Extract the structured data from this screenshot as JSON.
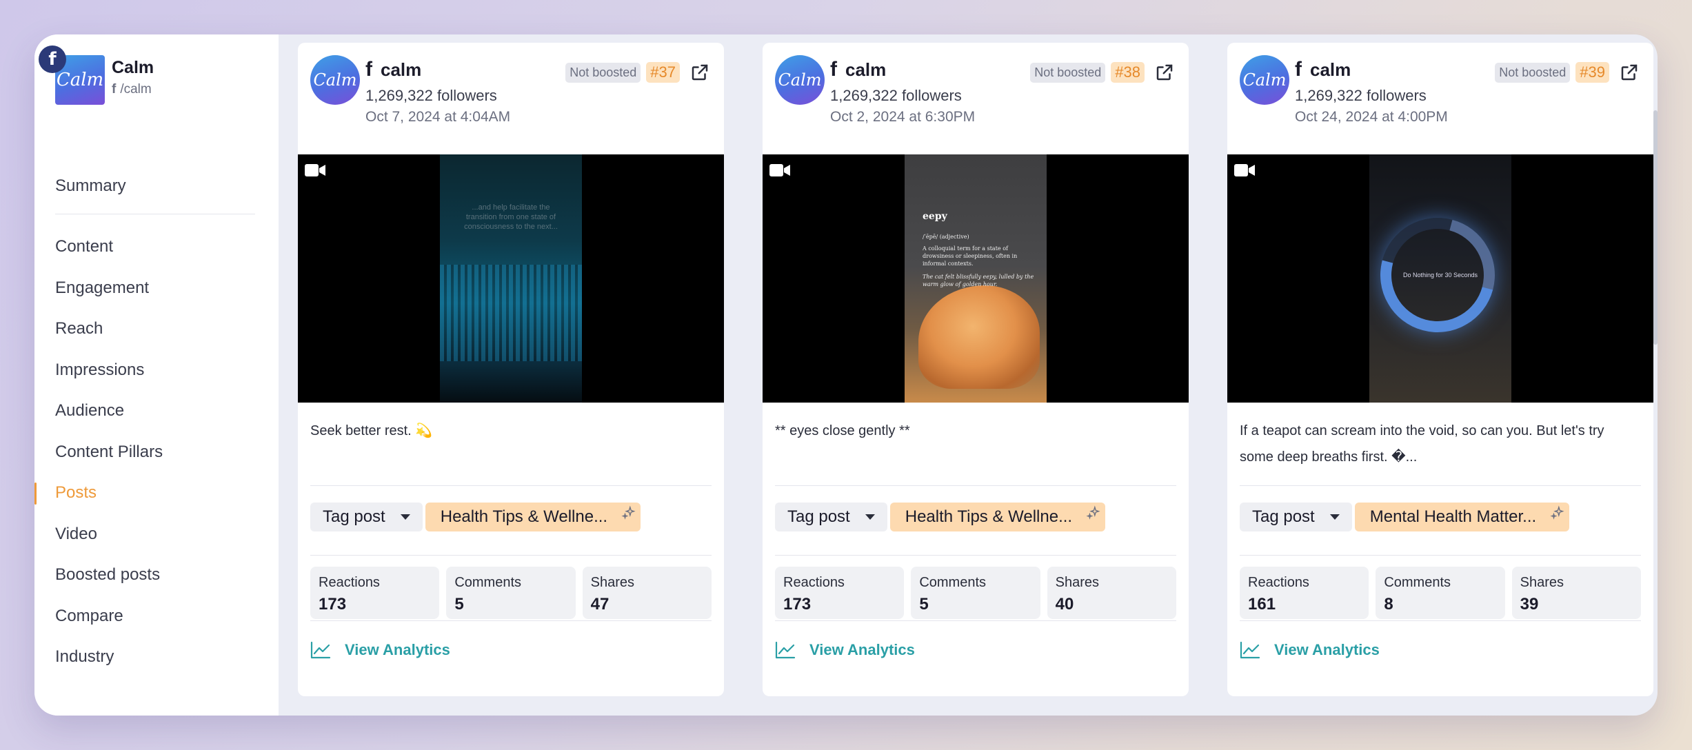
{
  "sidebar": {
    "platform_glyph": "f",
    "brand_logo_text": "Calm",
    "account_name": "Calm",
    "account_handle": "/calm",
    "nav_top": "Summary",
    "nav": [
      "Content",
      "Engagement",
      "Reach",
      "Impressions",
      "Audience",
      "Content Pillars",
      "Posts",
      "Video",
      "Boosted posts",
      "Compare",
      "Industry"
    ],
    "active": "Posts"
  },
  "posts": [
    {
      "avatar_text": "Calm",
      "account": "calm",
      "followers": "1,269,322 followers",
      "date": "Oct 7, 2024 at 4:04AM",
      "boost_status": "Not boosted",
      "rank": "#37",
      "media_text": "...and help facilitate the transition from one state of consciousness to the next...",
      "caption": "Seek better rest. 💫",
      "tag_label": "Tag post",
      "pillar": "Health Tips & Wellne...",
      "stats": [
        {
          "label": "Reactions",
          "value": "173"
        },
        {
          "label": "Comments",
          "value": "5"
        },
        {
          "label": "Shares",
          "value": "47"
        }
      ],
      "analytics_label": "View Analytics"
    },
    {
      "avatar_text": "Calm",
      "account": "calm",
      "followers": "1,269,322 followers",
      "date": "Oct 2, 2024 at 6:30PM",
      "boost_status": "Not boosted",
      "rank": "#38",
      "media_word": "eepy",
      "media_pos": "/ˈēpē/ (adjective)",
      "media_def": "A colloquial term for a state of drowsiness or sleepiness, often in informal contexts.",
      "media_example": "The cat felt blissfully eepy, lulled by the warm glow of golden hour.",
      "caption": "** eyes close gently **",
      "tag_label": "Tag post",
      "pillar": "Health Tips & Wellne...",
      "stats": [
        {
          "label": "Reactions",
          "value": "173"
        },
        {
          "label": "Comments",
          "value": "5"
        },
        {
          "label": "Shares",
          "value": "40"
        }
      ],
      "analytics_label": "View Analytics"
    },
    {
      "avatar_text": "Calm",
      "account": "calm",
      "followers": "1,269,322 followers",
      "date": "Oct 24, 2024 at 4:00PM",
      "boost_status": "Not boosted",
      "rank": "#39",
      "media_text": "Do Nothing for 30 Seconds",
      "caption": "If a teapot can scream into the void, so can you. But let's try some deep breaths first. �...",
      "tag_label": "Tag post",
      "pillar": "Mental Health Matter...",
      "stats": [
        {
          "label": "Reactions",
          "value": "161"
        },
        {
          "label": "Comments",
          "value": "8"
        },
        {
          "label": "Shares",
          "value": "39"
        }
      ],
      "analytics_label": "View Analytics"
    }
  ],
  "colors": {
    "accent": "#ee9a3a",
    "link": "#2a9fa6",
    "rank_bg": "#fde2bf",
    "pillar_bg": "#fddab0"
  }
}
